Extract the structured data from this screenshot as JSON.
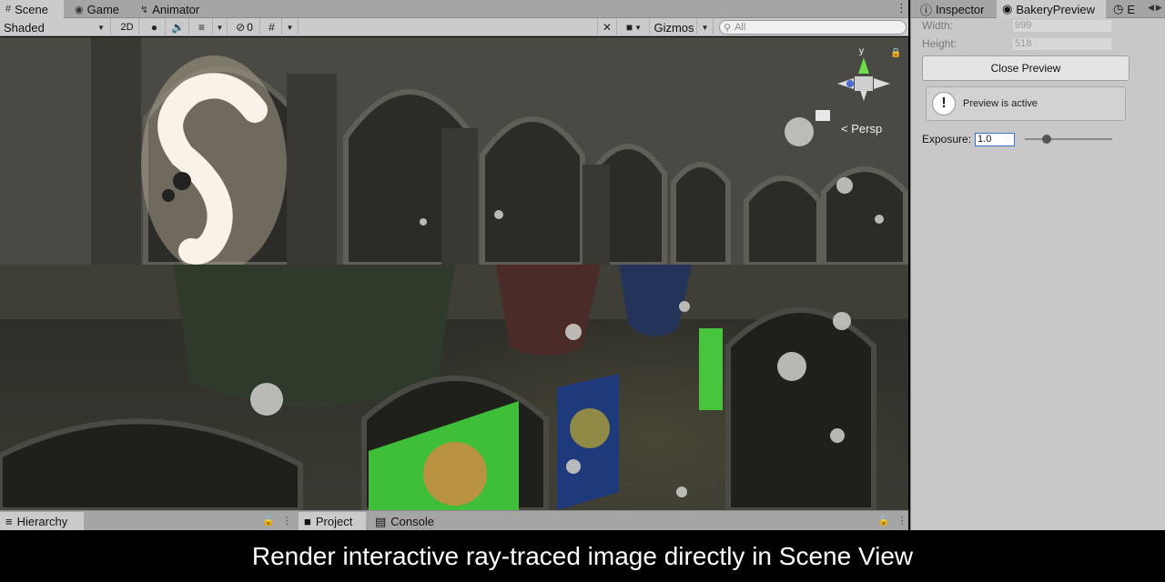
{
  "scene_tabs": [
    {
      "label": "Scene",
      "icon": "grid-icon"
    },
    {
      "label": "Game",
      "icon": "gamepad-icon"
    },
    {
      "label": "Animator",
      "icon": "animator-icon"
    }
  ],
  "toolbar": {
    "draw_mode": "Shaded",
    "mode_2d": "2D",
    "hidden_count": "0",
    "gizmos_label": "Gizmos",
    "search_placeholder": "All"
  },
  "viewport": {
    "projection_label": "Persp",
    "gizmo_axis_y": "y"
  },
  "bottom_tabs": [
    {
      "label": "Hierarchy",
      "icon": "list-icon"
    },
    {
      "label": "Project",
      "icon": "folder-icon"
    },
    {
      "label": "Console",
      "icon": "console-icon"
    }
  ],
  "right_panel": {
    "tabs": [
      {
        "label": "Inspector",
        "icon": "info-icon"
      },
      {
        "label": "BakeryPreview",
        "icon": "preview-icon"
      },
      {
        "label": "E",
        "icon": "clock-icon"
      }
    ],
    "width_label": "Width:",
    "width_value": "999",
    "height_label": "Height:",
    "height_value": "518",
    "close_button": "Close Preview",
    "help_text": "Preview is active",
    "exposure_label": "Exposure:",
    "exposure_value": "1.0",
    "exposure_slider": 0.25
  },
  "caption": "Render interactive ray-traced image directly in Scene View",
  "colors": {
    "toolbar_bg": "#cbcbcb",
    "tab_bg": "#a5a5a5",
    "panel_bg": "#c8c8c8",
    "focus_blue": "#3a72c4"
  }
}
